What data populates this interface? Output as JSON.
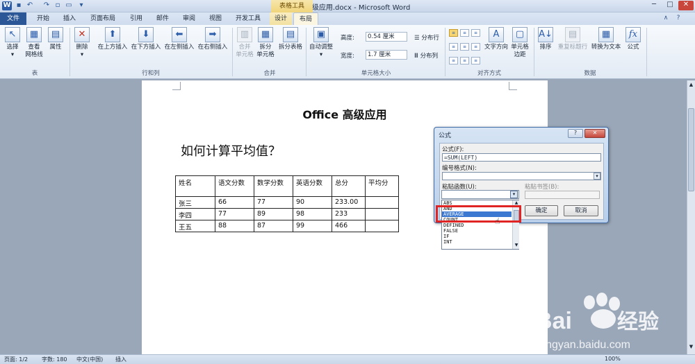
{
  "window": {
    "title": "Office高级应用.docx - Microsoft Word",
    "context_group": "表格工具"
  },
  "tabs": [
    {
      "label": "文件"
    },
    {
      "label": "开始"
    },
    {
      "label": "插入"
    },
    {
      "label": "页面布局"
    },
    {
      "label": "引用"
    },
    {
      "label": "邮件"
    },
    {
      "label": "审阅"
    },
    {
      "label": "视图"
    },
    {
      "label": "开发工具"
    },
    {
      "label": "设计"
    },
    {
      "label": "布局"
    }
  ],
  "ribbon": {
    "groups": {
      "table": "表",
      "rows_cols": "行和列",
      "merge": "合并",
      "cell_size": "单元格大小",
      "alignment": "对齐方式",
      "data": "数据"
    },
    "buttons": {
      "select": "选择",
      "view_grid_1": "查看",
      "view_grid_2": "网格线",
      "properties": "属性",
      "delete": "删除",
      "insert_above": "在上方插入",
      "insert_below": "在下方插入",
      "insert_left": "在左侧插入",
      "insert_right": "在右侧插入",
      "merge_cells_1": "合并",
      "merge_cells_2": "单元格",
      "split_cells_1": "拆分",
      "split_cells_2": "单元格",
      "split_table": "拆分表格",
      "autofit": "自动调整",
      "height_label": "高度:",
      "height_value": "0.54 厘米",
      "width_label": "宽度:",
      "width_value": "1.7 厘米",
      "distribute_rows": "分布行",
      "distribute_cols": "分布列",
      "text_direction": "文字方向",
      "cell_margins_1": "单元格",
      "cell_margins_2": "边距",
      "sort": "排序",
      "repeat_header": "重复标题行",
      "convert_text": "转换为文本",
      "formula": "公式"
    }
  },
  "document": {
    "title": "Office 高级应用",
    "subtitle": "如何计算平均值？",
    "table": {
      "headers": [
        "姓名",
        "语文分数",
        "数学分数",
        "英语分数",
        "总分",
        "平均分"
      ],
      "rows": [
        [
          "张三",
          "66",
          "77",
          "90",
          "233.00",
          ""
        ],
        [
          "李四",
          "77",
          "89",
          "98",
          "233",
          ""
        ],
        [
          "王五",
          "88",
          "87",
          "99",
          "466",
          ""
        ]
      ]
    }
  },
  "dialog": {
    "title": "公式",
    "formula_label": "公式(F):",
    "formula_value": "=SUM(LEFT)",
    "number_format_label": "编号格式(N):",
    "paste_function_label": "粘贴函数(U):",
    "paste_bookmark_label": "粘贴书签(B):",
    "ok": "确定",
    "cancel": "取消",
    "help": "?",
    "close": "✕",
    "functions": [
      "ABS",
      "AND",
      "AVERAGE",
      "COUNT",
      "DEFINED",
      "FALSE",
      "IF",
      "INT"
    ],
    "selected_function": "AVERAGE"
  },
  "statusbar": {
    "page": "页面: 1/2",
    "words": "字数: 180",
    "language": "中文(中国)",
    "mode": "插入",
    "zoom": "100%"
  },
  "watermark": {
    "brand": "Bai",
    "brand2": "经验",
    "url": "jingyan.baidu.com"
  }
}
